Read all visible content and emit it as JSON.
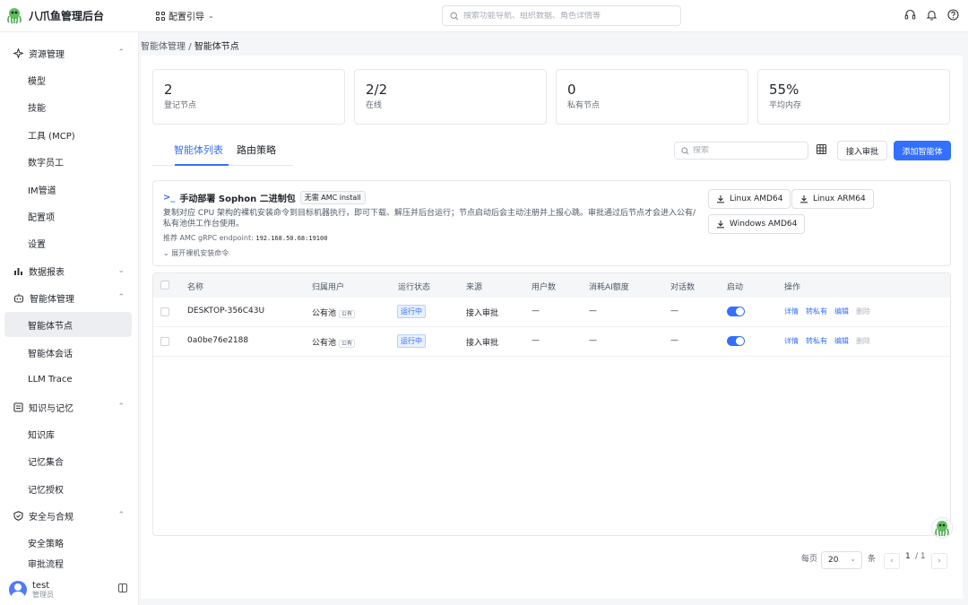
{
  "app": {
    "title": "八爪鱼管理后台"
  },
  "header": {
    "guide_label": "配置引导",
    "search_placeholder": "搜索功能导航、组织数据、角色详情等"
  },
  "sidebar": {
    "groups": {
      "resources": {
        "label": "资源管理",
        "items": [
          "模型",
          "技能",
          "工具 (MCP)",
          "数字员工",
          "IM管道",
          "配置项",
          "设置"
        ]
      },
      "reports": {
        "label": "数据报表"
      },
      "agents": {
        "label": "智能体管理",
        "items": [
          "智能体节点",
          "智能体会话",
          "LLM Trace"
        ]
      },
      "knowledge": {
        "label": "知识与记忆",
        "items": [
          "知识库",
          "记忆集合",
          "记忆授权"
        ]
      },
      "security": {
        "label": "安全与合规",
        "items": [
          "安全策略",
          "审批流程"
        ]
      }
    },
    "active_item": "智能体节点",
    "user": {
      "name": "test",
      "role": "管理员"
    }
  },
  "breadcrumb": {
    "parent": "智能体管理",
    "separator": "/",
    "current": "智能体节点"
  },
  "stats": [
    {
      "value": "2",
      "label": "登记节点"
    },
    {
      "value": "2/2",
      "label": "在线"
    },
    {
      "value": "0",
      "label": "私有节点"
    },
    {
      "value": "55%",
      "label": "平均内存"
    }
  ],
  "tabs": {
    "list": "智能体列表",
    "routing": "路由策略",
    "active": "智能体列表"
  },
  "toolbar": {
    "search_placeholder": "搜索",
    "approve_label": "接入审批",
    "add_label": "添加智能体"
  },
  "deploy": {
    "title": "手动部署 Sophon 二进制包",
    "tag": "无需 AMC install",
    "description": "复制对应 CPU 架构的裸机安装命令到目标机器执行，即可下载、解压并后台运行；节点启动后会主动注册并上报心跳。审批通过后节点才会进入公有/私有池供工作台使用。",
    "endpoint_label": "推荐 AMC gRPC endpoint:",
    "endpoint_value": "192.168.50.68:19100",
    "expand_label": "展开裸机安装命令",
    "downloads": [
      "Linux AMD64",
      "Linux ARM64",
      "Windows AMD64"
    ]
  },
  "table": {
    "columns": [
      "名称",
      "归属用户",
      "运行状态",
      "来源",
      "用户数",
      "消耗AI额度",
      "对话数",
      "启动",
      "操作"
    ],
    "rows": [
      {
        "name": "DESKTOP-356C43U",
        "owner": "公有池",
        "owner_tag": "公有",
        "status": "运行中",
        "source": "接入审批",
        "users": "—",
        "quota": "—",
        "chats": "—",
        "enabled": true
      },
      {
        "name": "0a0be76e2188",
        "owner": "公有池",
        "owner_tag": "公有",
        "status": "运行中",
        "source": "接入审批",
        "users": "—",
        "quota": "—",
        "chats": "—",
        "enabled": true
      }
    ],
    "actions": {
      "detail": "详情",
      "to_private": "转私有",
      "edit": "编辑",
      "delete": "删除"
    }
  },
  "pagination": {
    "per_page_label": "每页",
    "page_size": "20",
    "unit": "条",
    "current": "1",
    "total": "/ 1"
  },
  "colors": {
    "accent": "#3370ff",
    "status_bg": "#e8f0ff"
  }
}
